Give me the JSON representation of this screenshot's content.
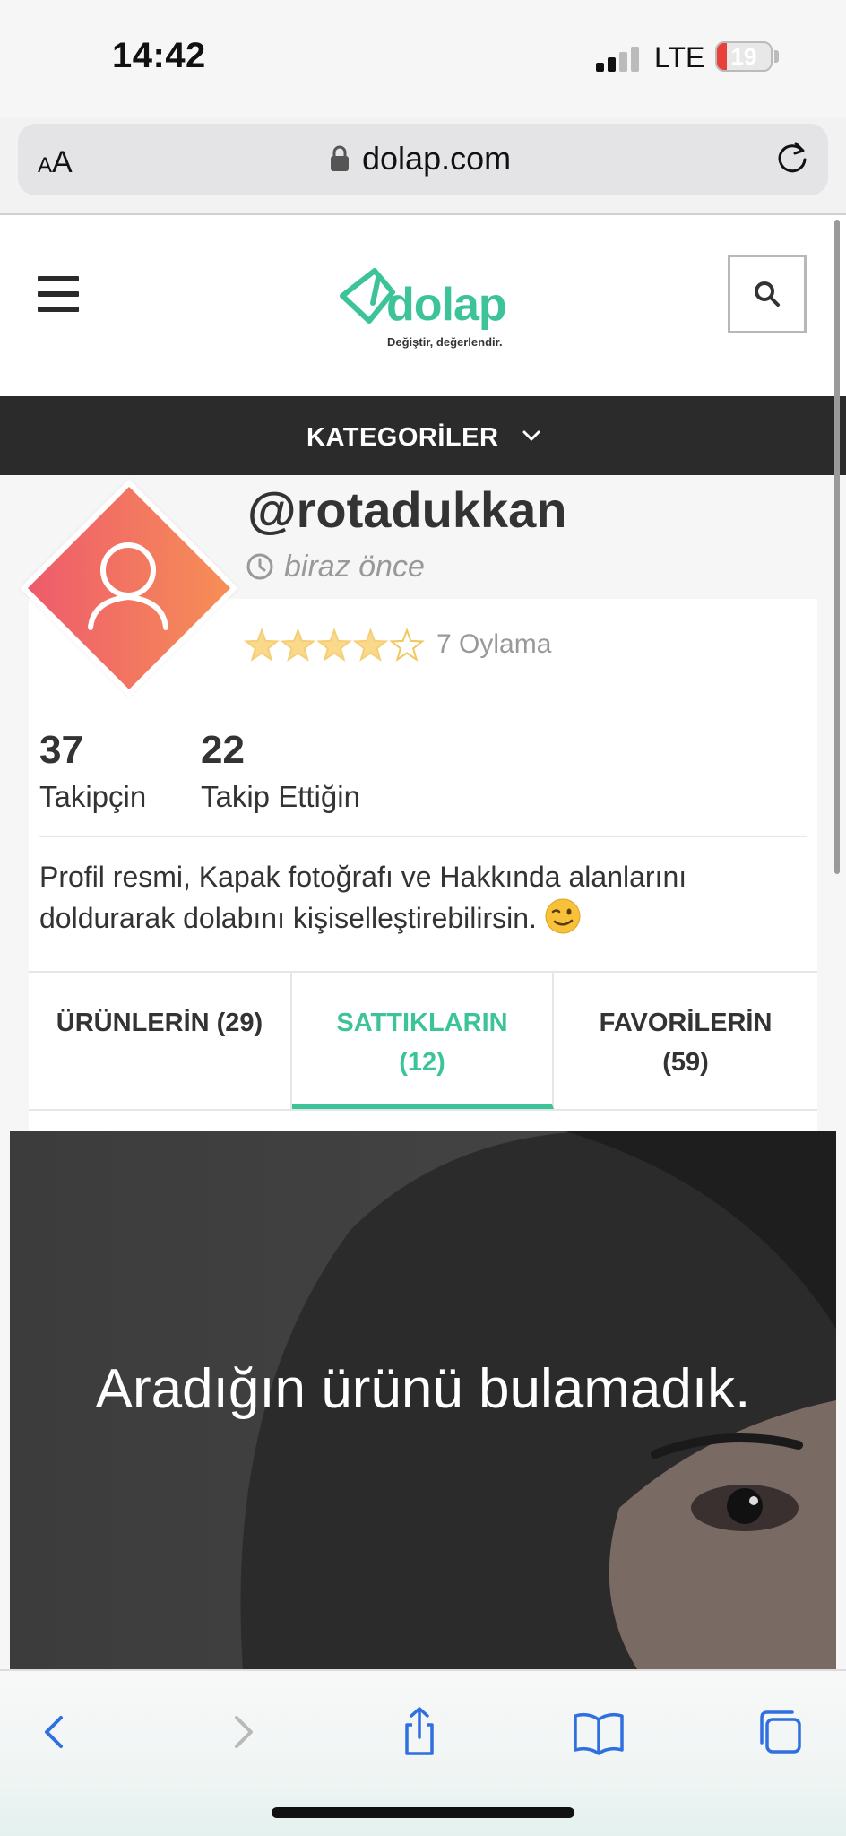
{
  "status_bar": {
    "time": "14:42",
    "network": "LTE",
    "battery": "19",
    "battery_level": 0.19,
    "battery_color": "#e8403a"
  },
  "browser": {
    "text_size_label": "AA",
    "url": "dolap.com",
    "icons": [
      "lock-icon",
      "reload-icon"
    ]
  },
  "header": {
    "logo_word": "dolap",
    "logo_tagline": "Değiştir, değerlendir.",
    "brand_color": "#3cc39a",
    "icons": [
      "menu-icon",
      "search-icon"
    ]
  },
  "category_bar": {
    "label": "KATEGORİLER",
    "icon": "chevron-down-icon"
  },
  "profile": {
    "username": "@rotadukkan",
    "last_seen": "biraz önce",
    "rating_stars": 4,
    "rating_max": 5,
    "rating_count": "7 Oylama",
    "followers_count": "37",
    "followers_label": "Takipçin",
    "following_count": "22",
    "following_label": "Takip Ettiğin",
    "hint": "Profil resmi, Kapak fotoğrafı ve Hakkında alanlarını doldurarak dolabını kişiselleştirebilirsin."
  },
  "tabs": [
    {
      "line1": "ÜRÜNLERİN (29)",
      "line2": "",
      "active": false
    },
    {
      "line1": "SATTIKLARIN",
      "line2": "(12)",
      "active": true
    },
    {
      "line1": "FAVORİLERİN",
      "line2": "(59)",
      "active": false
    }
  ],
  "empty_state": {
    "message": "Aradığın ürünü bulamadık."
  },
  "toolbar": {
    "icons": [
      "back-icon",
      "forward-icon",
      "share-icon",
      "bookmarks-icon",
      "tabs-icon"
    ]
  }
}
